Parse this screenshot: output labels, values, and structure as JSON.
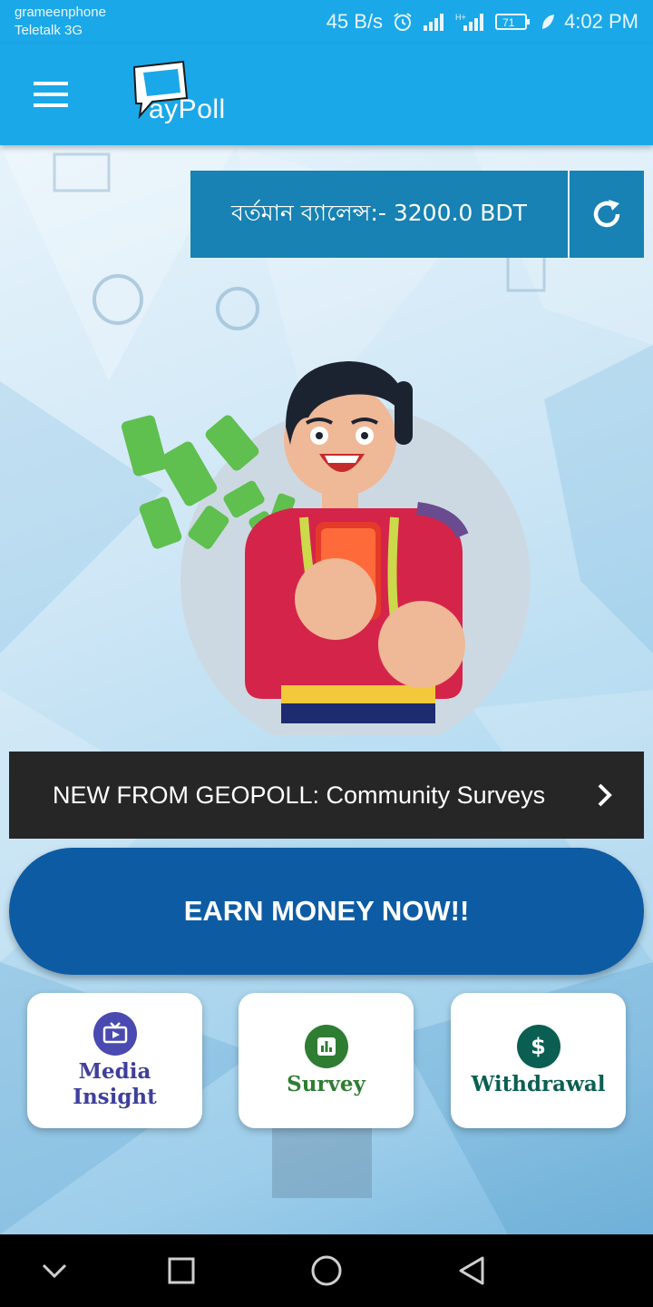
{
  "status_bar": {
    "carrier_1": "grameenphone",
    "carrier_2": "Teletalk 3G",
    "net_speed": "45 B/s",
    "battery": "71",
    "time": "4:02 PM",
    "icons": [
      "alarm-icon",
      "signal-icon",
      "signal-h-icon",
      "battery-icon",
      "leaf-icon"
    ]
  },
  "app_bar": {
    "logo_text": "ayPoll",
    "menu_icon": "hamburger-menu-icon"
  },
  "balance": {
    "text": "বর্তমান ব্যালেন্স:- 3200.0 BDT",
    "refresh_icon": "refresh-icon"
  },
  "banner": {
    "text": "NEW FROM GEOPOLL: Community Surveys",
    "arrow_icon": "chevron-right-icon"
  },
  "earn_button": {
    "label": "EARN MONEY NOW!!"
  },
  "tiles": [
    {
      "label_1": "Media",
      "label_2": "Insight",
      "icon": "tv-icon",
      "color": "#3f3f9b"
    },
    {
      "label_1": "Survey",
      "icon": "bar-chart-icon",
      "color": "#2e7d32"
    },
    {
      "label_1": "Withdrawal",
      "icon": "dollar-icon",
      "color": "#0b5f52"
    }
  ],
  "colors": {
    "primary": "#1ba8e8",
    "balance_bg": "#1782b3",
    "earn_bg": "#0d5ba3",
    "banner_bg": "#262626"
  },
  "nav_bar": {
    "icons": [
      "back-chevron-icon",
      "recents-square-icon",
      "home-circle-icon",
      "back-triangle-icon"
    ]
  }
}
